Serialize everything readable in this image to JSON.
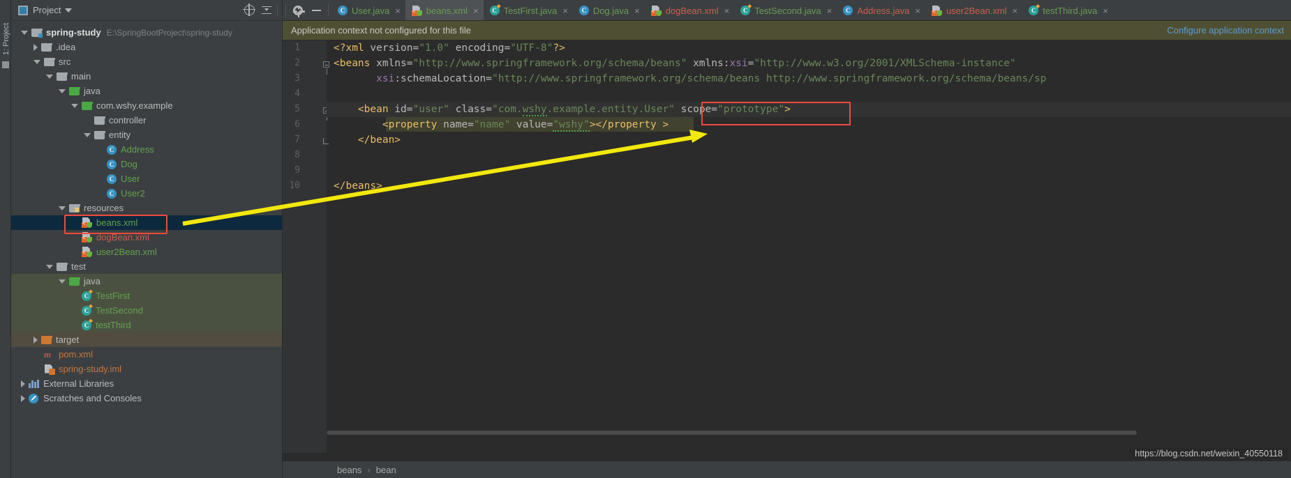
{
  "left_strip": {
    "label": "1: Project",
    "icon": "project-tool-window-icon"
  },
  "panel": {
    "title": "Project",
    "icon": "project-view-icon",
    "caret": "chevron-down-icon",
    "buttons": [
      {
        "name": "scroll-from-source-button",
        "icon": "target-icon"
      },
      {
        "name": "collapse-all-button",
        "icon": "collapse-all-icon"
      }
    ]
  },
  "tree": [
    {
      "label": "spring-study",
      "path": "E:\\SpringBootProject\\spring-study",
      "indent": 0,
      "arrow": "down",
      "icon": "module-folder",
      "style": "bold",
      "name": "tree-node-spring-study"
    },
    {
      "label": ".idea",
      "indent": 1,
      "arrow": "right",
      "icon": "folder",
      "style": "plain",
      "name": "tree-node-idea"
    },
    {
      "label": "src",
      "indent": 1,
      "arrow": "down",
      "icon": "folder",
      "style": "plain",
      "name": "tree-node-src"
    },
    {
      "label": "main",
      "indent": 2,
      "arrow": "down",
      "icon": "folder",
      "style": "plain",
      "name": "tree-node-main"
    },
    {
      "label": "java",
      "indent": 3,
      "arrow": "down",
      "icon": "folder-green",
      "style": "plain",
      "name": "tree-node-main-java"
    },
    {
      "label": "com.wshy.example",
      "indent": 4,
      "arrow": "down",
      "icon": "folder-green",
      "style": "plain",
      "name": "tree-node-package"
    },
    {
      "label": "controller",
      "indent": 5,
      "arrow": "none",
      "icon": "folder",
      "style": "plain",
      "name": "tree-node-controller"
    },
    {
      "label": "entity",
      "indent": 5,
      "arrow": "down",
      "icon": "folder",
      "style": "plain",
      "name": "tree-node-entity"
    },
    {
      "label": "Address",
      "indent": 6,
      "arrow": "none",
      "icon": "class",
      "style": "green",
      "name": "tree-node-address"
    },
    {
      "label": "Dog",
      "indent": 6,
      "arrow": "none",
      "icon": "class",
      "style": "green",
      "name": "tree-node-dog"
    },
    {
      "label": "User",
      "indent": 6,
      "arrow": "none",
      "icon": "class",
      "style": "green",
      "name": "tree-node-user"
    },
    {
      "label": "User2",
      "indent": 6,
      "arrow": "none",
      "icon": "class",
      "style": "green",
      "name": "tree-node-user2"
    },
    {
      "label": "resources",
      "indent": 3,
      "arrow": "down",
      "icon": "folder-res",
      "style": "plain",
      "name": "tree-node-resources"
    },
    {
      "label": "beans.xml",
      "indent": 4,
      "arrow": "none",
      "icon": "xml",
      "style": "green",
      "selected": true,
      "boxed": true,
      "name": "tree-node-beans-xml"
    },
    {
      "label": "dogBean.xml",
      "indent": 4,
      "arrow": "none",
      "icon": "xml",
      "style": "red",
      "name": "tree-node-dogbean-xml"
    },
    {
      "label": "user2Bean.xml",
      "indent": 4,
      "arrow": "none",
      "icon": "xml",
      "style": "green",
      "name": "tree-node-user2bean-xml"
    },
    {
      "label": "test",
      "indent": 2,
      "arrow": "down",
      "icon": "folder",
      "style": "plain",
      "name": "tree-node-test"
    },
    {
      "label": "java",
      "indent": 3,
      "arrow": "down",
      "icon": "folder-green",
      "style": "plain",
      "bg": "green",
      "name": "tree-node-test-java"
    },
    {
      "label": "TestFirst",
      "indent": 4,
      "arrow": "none",
      "icon": "test-class",
      "style": "green",
      "bg": "green",
      "name": "tree-node-testfirst"
    },
    {
      "label": "TestSecond",
      "indent": 4,
      "arrow": "none",
      "icon": "test-class",
      "style": "green",
      "bg": "green",
      "name": "tree-node-testsecond"
    },
    {
      "label": "testThird",
      "indent": 4,
      "arrow": "none",
      "icon": "test-class",
      "style": "green",
      "bg": "green",
      "name": "tree-node-testthird"
    },
    {
      "label": "target",
      "indent": 1,
      "arrow": "right",
      "icon": "folder-orange",
      "style": "plain",
      "bg": "brown",
      "name": "tree-node-target"
    },
    {
      "label": "pom.xml",
      "indent": 1,
      "arrow": "none",
      "icon": "maven",
      "style": "orange",
      "name": "tree-node-pom-xml"
    },
    {
      "label": "spring-study.iml",
      "indent": 1,
      "arrow": "none",
      "icon": "iml",
      "style": "orange",
      "name": "tree-node-iml"
    },
    {
      "label": "External Libraries",
      "indent": 0,
      "arrow": "right",
      "icon": "library",
      "style": "plain",
      "name": "tree-node-external-libraries"
    },
    {
      "label": "Scratches and Consoles",
      "indent": 0,
      "arrow": "right",
      "icon": "scratch",
      "style": "plain",
      "name": "tree-node-scratches"
    }
  ],
  "toolbar": {
    "settings_icon": "gear-icon",
    "hide_icon": "minimize-icon"
  },
  "tabs": [
    {
      "label": "User.java",
      "icon": "java-class-icon",
      "color": "green",
      "active": false,
      "name": "tab-user-java"
    },
    {
      "label": "beans.xml",
      "icon": "spring-xml-icon",
      "color": "green",
      "active": true,
      "name": "tab-beans-xml"
    },
    {
      "label": "TestFirst.java",
      "icon": "test-class-icon",
      "color": "green",
      "active": false,
      "name": "tab-testfirst-java"
    },
    {
      "label": "Dog.java",
      "icon": "java-class-icon",
      "color": "green",
      "active": false,
      "name": "tab-dog-java"
    },
    {
      "label": "dogBean.xml",
      "icon": "spring-xml-icon",
      "color": "red",
      "active": false,
      "name": "tab-dogbean-xml"
    },
    {
      "label": "TestSecond.java",
      "icon": "test-class-icon",
      "color": "green",
      "active": false,
      "name": "tab-testsecond-java"
    },
    {
      "label": "Address.java",
      "icon": "java-class-icon",
      "color": "red",
      "active": false,
      "name": "tab-address-java"
    },
    {
      "label": "user2Bean.xml",
      "icon": "spring-xml-icon",
      "color": "red",
      "active": false,
      "name": "tab-user2bean-xml"
    },
    {
      "label": "testThird.java",
      "icon": "test-class-icon",
      "color": "green",
      "active": false,
      "name": "tab-testthird-java"
    }
  ],
  "tab_close_glyph": "×",
  "notification": {
    "message": "Application context not configured for this file",
    "action": "Configure application context"
  },
  "editor": {
    "line_numbers": [
      "1",
      "2",
      "3",
      "4",
      "5",
      "6",
      "7",
      "8",
      "9",
      "10"
    ],
    "lines": {
      "l1": "<?xml version=\"1.0\" encoding=\"UTF-8\"?>",
      "l2": "<beans xmlns=\"http://www.springframework.org/schema/beans\" xmlns:xsi=\"http://www.w3.org/2001/XMLSchema-instance\"",
      "l3": "       xsi:schemaLocation=\"http://www.springframework.org/schema/beans http://www.springframework.org/schema/beans/sp",
      "l5": "<bean id=\"user\" class=\"com.wshy.example.entity.User\" scope=\"prototype\">",
      "l6": "<property name=\"name\" value=\"wshy\"></property >",
      "l7": "</bean>",
      "l10": "</beans>"
    },
    "highlighted_attribute": "scope=\"prototype\">"
  },
  "breadcrumb": {
    "items": [
      "beans",
      "bean"
    ],
    "separator": "›"
  },
  "watermark": "https://blog.csdn.net/weixin_40550118",
  "colors": {
    "accent_red": "#f04a3f",
    "arrow_yellow": "#f2e80c",
    "tag": "#e8bf6a",
    "value": "#6a8759",
    "namespace": "#9876aa",
    "selection_blue": "#0d293e",
    "notif_bg": "#4f5033",
    "link": "#5b9bd5"
  }
}
